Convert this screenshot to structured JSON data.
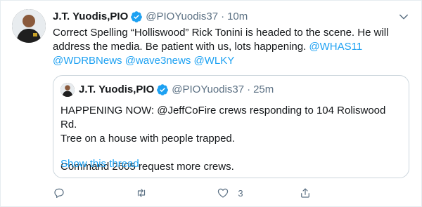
{
  "tweet": {
    "author_name": "J.T. Yuodis,PIO",
    "handle": "@PIOYuodis37",
    "separator": "·",
    "time": "10m",
    "text_before_links": "Correct Spelling “Holliswood” Rick Tonini is headed to the scene. He will address the media. Be patient with us, lots happening.",
    "mentions": [
      "@WHAS11",
      "@WDRBNews",
      "@wave3news",
      "@WLKY"
    ]
  },
  "quoted_tweet": {
    "author_name": "J.T. Yuodis,PIO",
    "handle": "@PIOYuodis37",
    "separator": "·",
    "time": "25m",
    "line1": "HAPPENING NOW: @JeffCoFire crews responding to 104 Roliswood Rd.",
    "line2": "Tree on a house with people trapped.",
    "line3": "Command 2605 request more crews.",
    "show_thread_label": "Show this thread"
  },
  "actions": {
    "reply_count": "",
    "retweet_count": "",
    "like_count": "3",
    "share_count": ""
  },
  "colors": {
    "link": "#1da1f2",
    "verified": "#1da1f2",
    "secondary_text": "#5b7083"
  },
  "icons": [
    "verified-badge-icon",
    "chevron-down-icon",
    "reply-icon",
    "retweet-icon",
    "like-icon",
    "share-icon"
  ]
}
